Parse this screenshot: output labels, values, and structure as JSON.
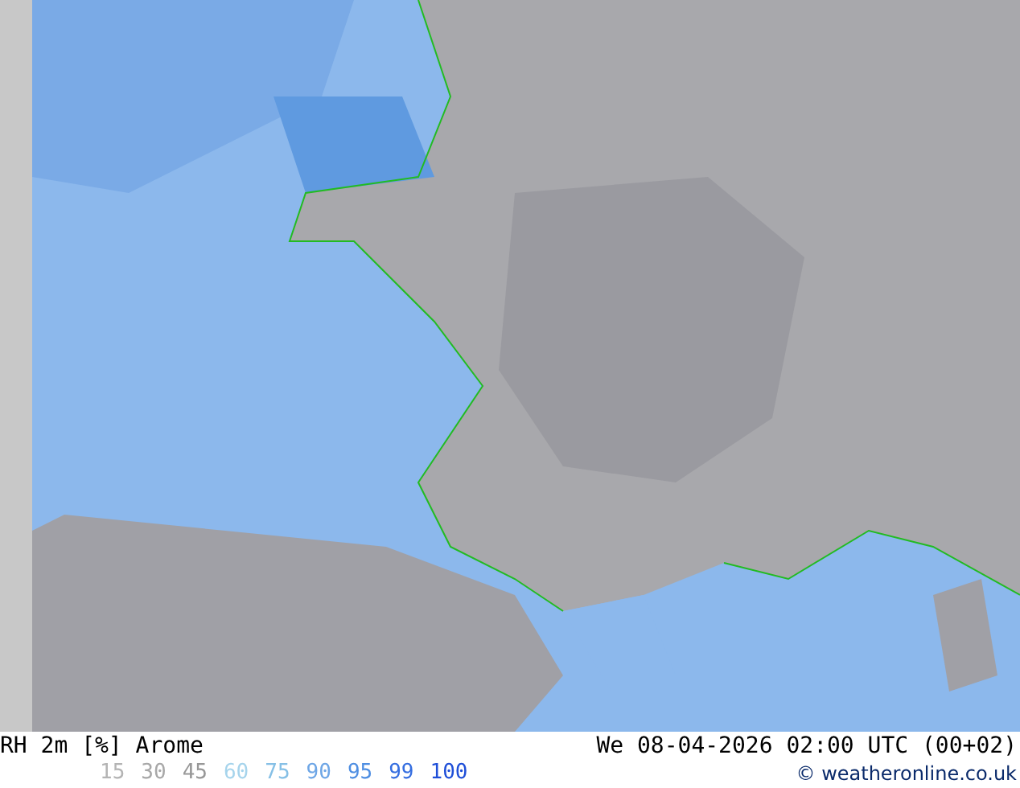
{
  "map": {
    "kind": "humidity-map"
  },
  "footer": {
    "title": "RH 2m [%] Arome",
    "datetime": "We 08-04-2026 02:00 UTC (00+02)",
    "credit": "© weatheronline.co.uk",
    "legend": [
      {
        "label": "15",
        "color": "#b4b4b4"
      },
      {
        "label": "30",
        "color": "#a8a8a8"
      },
      {
        "label": "45",
        "color": "#989898"
      },
      {
        "label": "60",
        "color": "#a6d4ec"
      },
      {
        "label": "75",
        "color": "#86c0e6"
      },
      {
        "label": "90",
        "color": "#6ea6e6"
      },
      {
        "label": "95",
        "color": "#4e8ee2"
      },
      {
        "label": "99",
        "color": "#356ee0"
      },
      {
        "label": "100",
        "color": "#1f4fd8"
      }
    ]
  }
}
